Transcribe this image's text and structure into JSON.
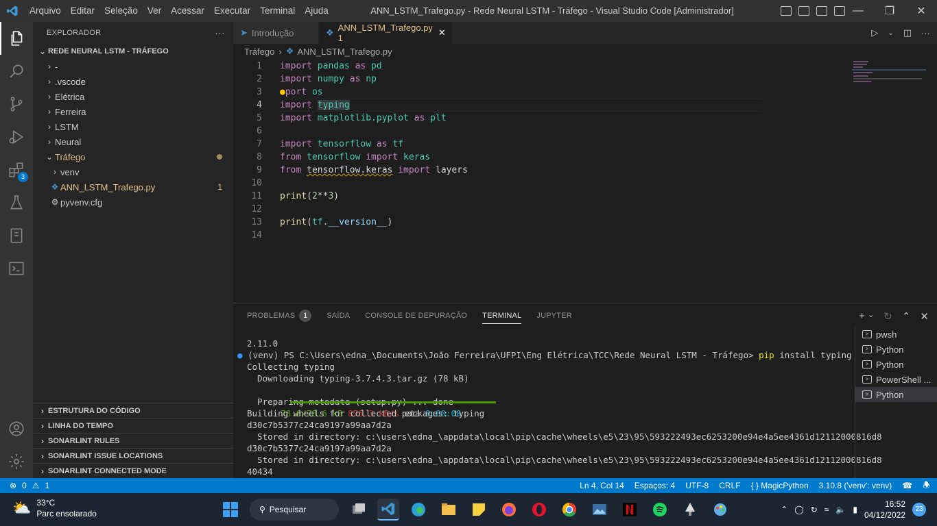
{
  "menu": [
    "Arquivo",
    "Editar",
    "Seleção",
    "Ver",
    "Acessar",
    "Executar",
    "Terminal",
    "Ajuda"
  ],
  "window_title": "ANN_LSTM_Trafego.py - Rede Neural LSTM - Tráfego - Visual Studio Code [Administrador]",
  "activity_badge": "3",
  "explorer": {
    "title": "EXPLORADOR",
    "more": "···",
    "root": "REDE NEURAL LSTM - TRÁFEGO",
    "items": [
      {
        "label": "-"
      },
      {
        "label": ".vscode"
      },
      {
        "label": "Elétrica"
      },
      {
        "label": "Ferreira"
      },
      {
        "label": "LSTM"
      },
      {
        "label": "Neural"
      },
      {
        "label": "Tráfego"
      },
      {
        "label": "venv"
      },
      {
        "label": "ANN_LSTM_Trafego.py",
        "count": "1"
      },
      {
        "label": "pyvenv.cfg"
      }
    ],
    "panes": [
      "ESTRUTURA DO CÓDIGO",
      "LINHA DO TEMPO",
      "SONARLINT RULES",
      "SONARLINT ISSUE LOCATIONS",
      "SONARLINT CONNECTED MODE"
    ]
  },
  "tabs": [
    {
      "label": "Introdução"
    },
    {
      "label": "ANN_LSTM_Trafego.py 1"
    }
  ],
  "breadcrumb": {
    "folder": "Tráfego",
    "file": "ANN_LSTM_Trafego.py"
  },
  "code": {
    "line_numbers": [
      "1",
      "2",
      "3",
      "4",
      "5",
      "6",
      "7",
      "8",
      "9",
      "10",
      "11",
      "12",
      "13",
      "14"
    ],
    "l1": [
      "import",
      " pandas",
      " as",
      " pd"
    ],
    "l2": [
      "import",
      " numpy",
      " as",
      " np"
    ],
    "l3": [
      "port",
      " os"
    ],
    "l4": [
      "import",
      " ",
      "typing"
    ],
    "l5": [
      "import",
      " matplotlib.pyplot",
      " as",
      " plt"
    ],
    "l7": [
      "import",
      " tensorflow",
      " as",
      " tf"
    ],
    "l8": [
      "from",
      " tensorflow",
      " import",
      " keras"
    ],
    "l9": [
      "from",
      " ",
      "tensorflow.keras",
      " import",
      " layers"
    ],
    "l11": [
      "print",
      "(",
      "2",
      "**",
      "3",
      ")"
    ],
    "l13": [
      "print",
      "(",
      "tf",
      ".__version__",
      ")"
    ]
  },
  "panel": {
    "tabs": [
      "PROBLEMAS",
      "SAÍDA",
      "CONSOLE DE DEPURAÇÃO",
      "TERMINAL",
      "JUPYTER"
    ],
    "problems_count": "1",
    "terminal_lines": [
      "2.11.0",
      "(venv) PS C:\\Users\\edna_\\Documents\\João Ferreira\\UFPI\\Eng Elétrica\\TCC\\Rede Neural LSTM - Tráfego>",
      "Collecting typing",
      "  Downloading typing-3.7.4.3.tar.gz (78 kB)",
      "",
      "  Preparing metadata (setup.py) ... done",
      "Building wheels for collected packages: typing",
      "d30c7b5377c24ca9197a99aa7d2a",
      "  Stored in directory: c:\\users\\edna_\\appdata\\local\\pip\\cache\\wheels\\e5\\23\\95\\593222493ec6253200e94e4a5ee4361d12112000816d8",
      "d30c7b5377c24ca9197a99aa7d2a",
      "  Stored in directory: c:\\users\\edna_\\appdata\\local\\pip\\cache\\wheels\\e5\\23\\95\\593222493ec6253200e94e4a5ee4361d12112000816d8",
      "40434"
    ],
    "cmd_pip": "pip",
    "cmd_rest": " install typing",
    "progress_size": "78.6/78.6 kB",
    "progress_speed": "876.3 kB/s",
    "progress_eta_label": "eta",
    "progress_eta": "0:00:00",
    "progress_fraction": 1.0,
    "terminals": [
      "pwsh",
      "Python",
      "Python",
      "PowerShell ...",
      "Python"
    ]
  },
  "status": {
    "errors": "0",
    "warnings": "1",
    "position": "Ln 4, Col 14",
    "spaces": "Espaços: 4",
    "encoding": "UTF-8",
    "eol": "CRLF",
    "language": "MagicPython",
    "interpreter": "3.10.8 ('venv': venv)"
  },
  "taskbar": {
    "temp": "33°C",
    "weather": "Parc ensolarado",
    "search": "Pesquisar",
    "time": "16:52",
    "date": "04/12/2022",
    "notifications": "23"
  },
  "colors": {
    "accent": "#007acc",
    "modified": "#e2c08d",
    "progress": "#4e9a06"
  }
}
